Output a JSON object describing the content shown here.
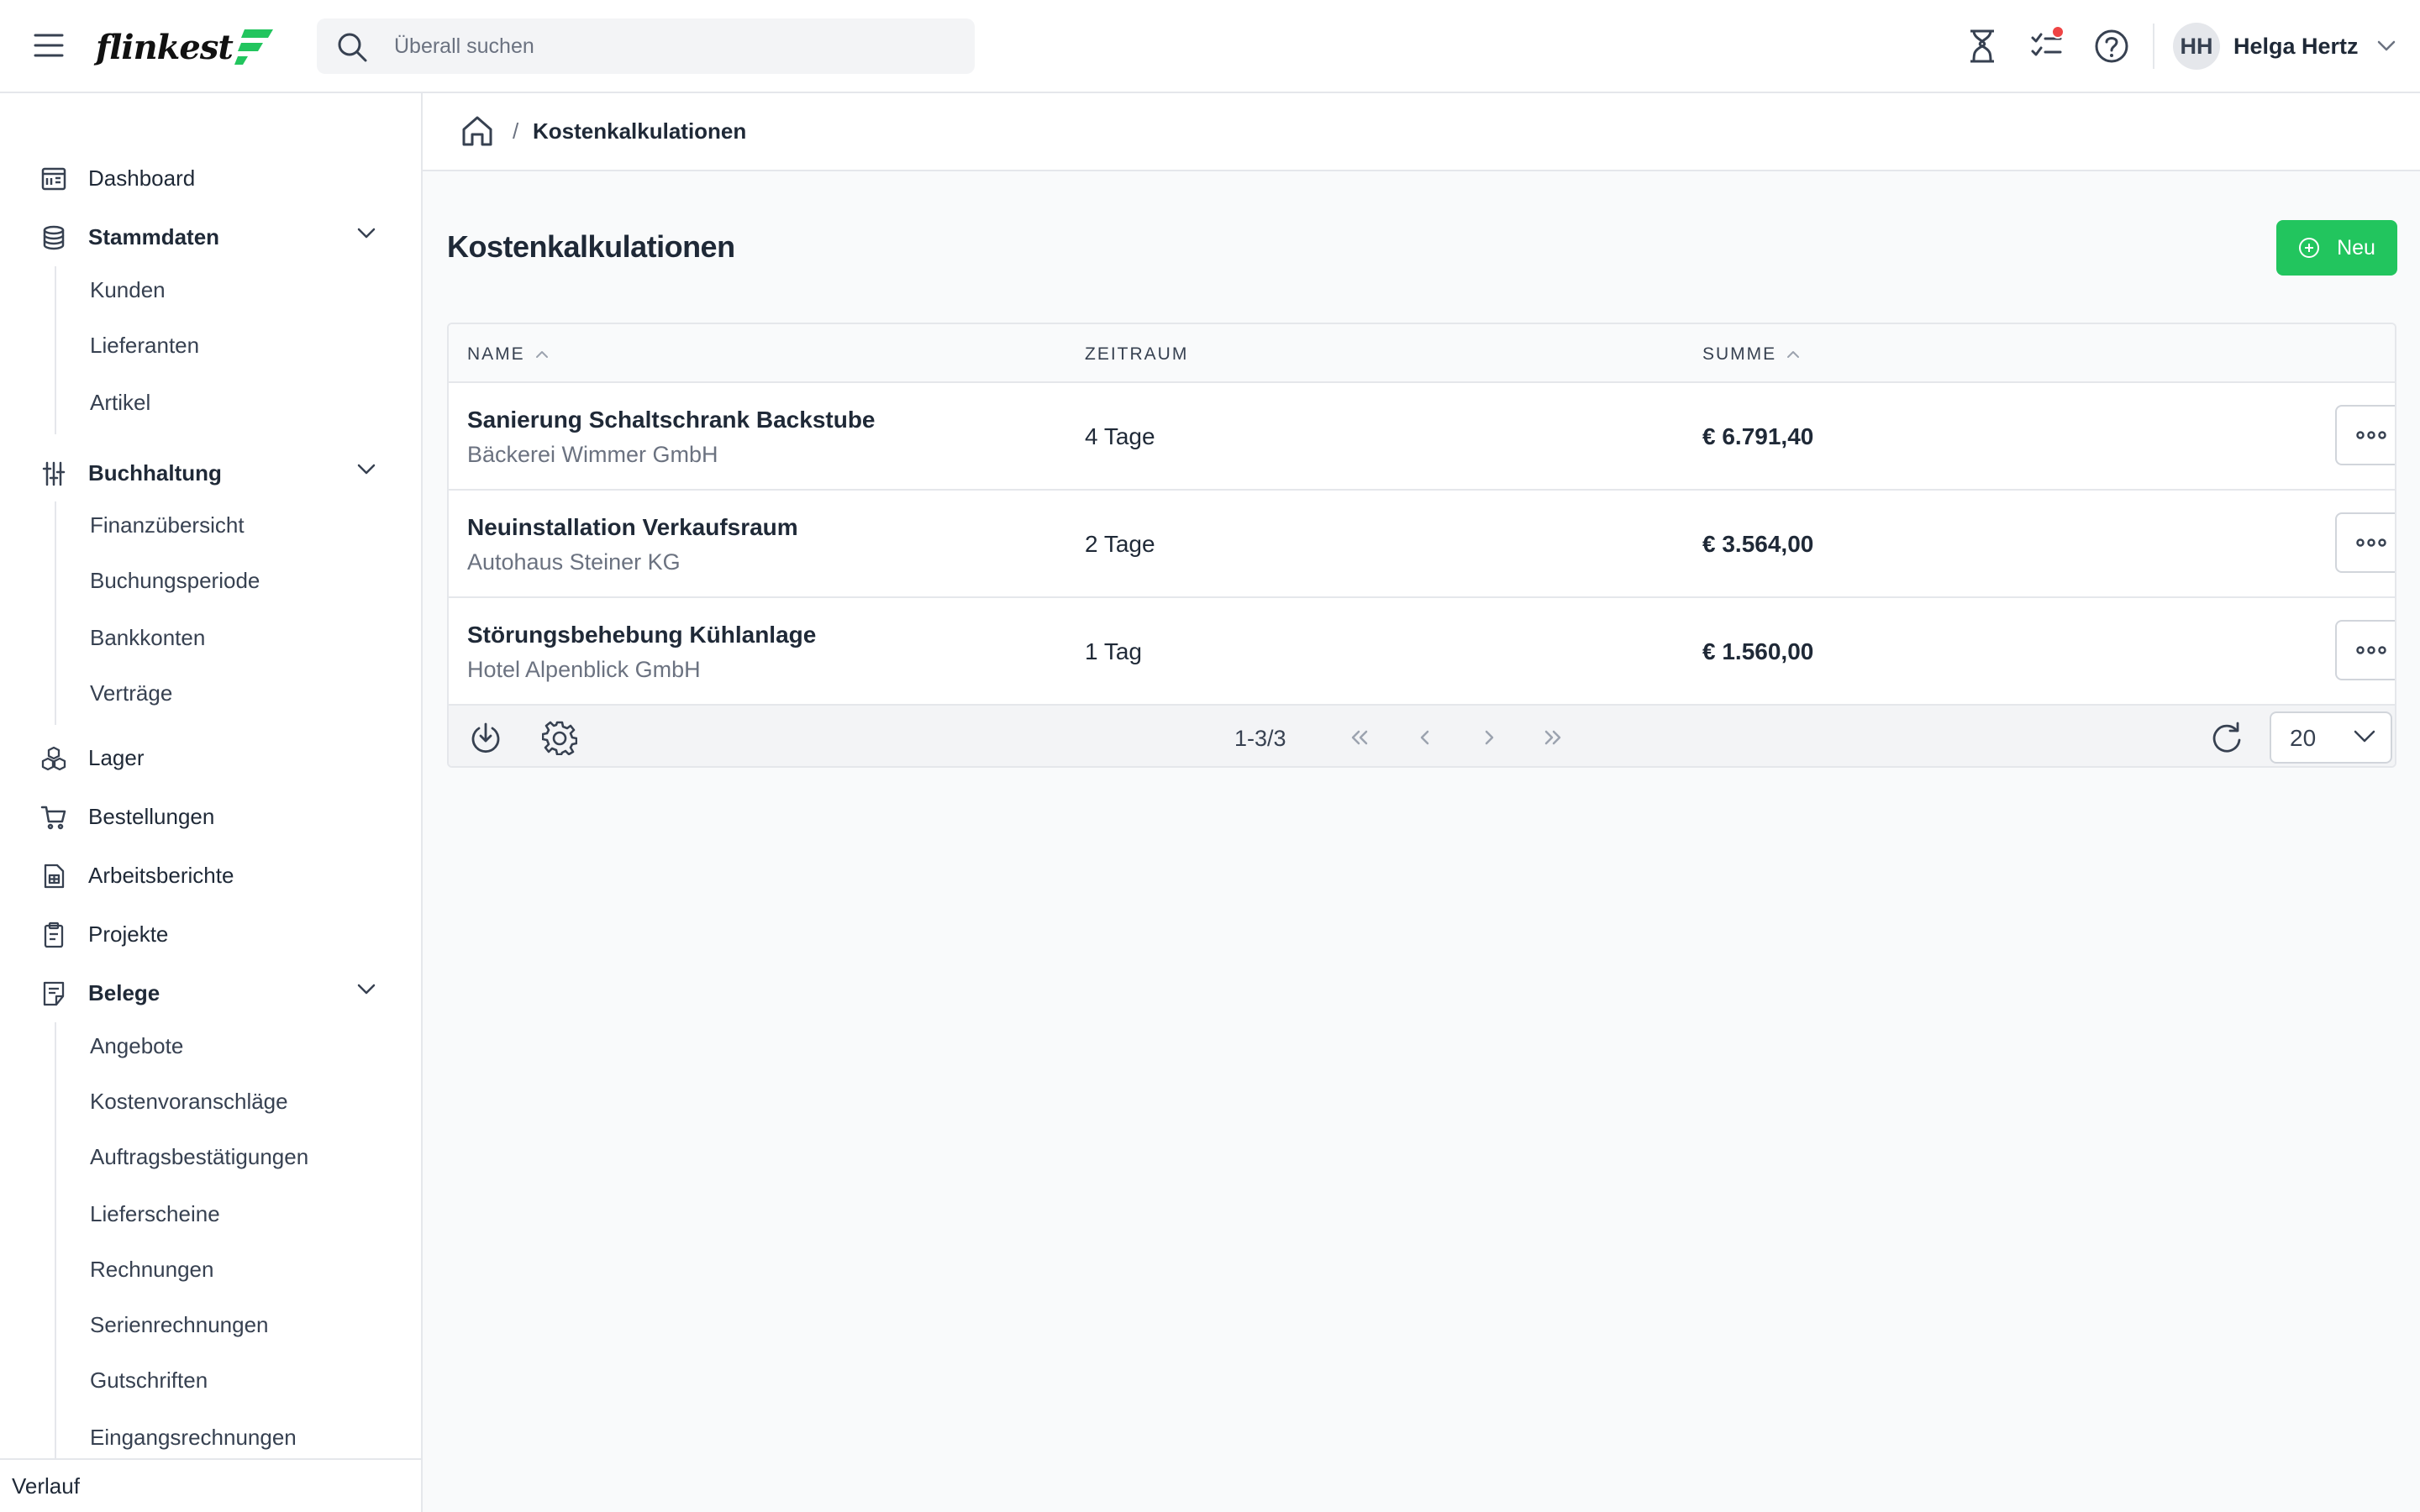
{
  "app": {
    "logo_text": "flinkest",
    "search_placeholder": "Überall suchen",
    "user_initials": "HH",
    "user_name": "Helga Hertz"
  },
  "sidebar": {
    "dashboard": "Dashboard",
    "stammdaten": {
      "label": "Stammdaten",
      "items": [
        "Kunden",
        "Lieferanten",
        "Artikel"
      ]
    },
    "buchhaltung": {
      "label": "Buchhaltung",
      "items": [
        "Finanzübersicht",
        "Buchungsperiode",
        "Bankkonten",
        "Verträge"
      ]
    },
    "lager": "Lager",
    "bestellungen": "Bestellungen",
    "arbeitsberichte": "Arbeitsberichte",
    "projekte": "Projekte",
    "belege": {
      "label": "Belege",
      "items": [
        "Angebote",
        "Kostenvoranschläge",
        "Auftragsbestätigungen",
        "Lieferscheine",
        "Rechnungen",
        "Serienrechnungen",
        "Gutschriften",
        "Eingangsrechnungen"
      ]
    },
    "footer": "Verlauf"
  },
  "breadcrumb": {
    "separator": "/",
    "current": "Kostenkalkulationen"
  },
  "page": {
    "title": "Kostenkalkulationen",
    "new_button": "Neu"
  },
  "table": {
    "headers": {
      "name": "NAME",
      "period": "ZEITRAUM",
      "sum": "SUMME"
    },
    "rows": [
      {
        "name": "Sanierung Schaltschrank Backstube",
        "customer": "Bäckerei Wimmer GmbH",
        "period": "4 Tage",
        "sum": "€ 6.791,40"
      },
      {
        "name": "Neuinstallation Verkaufsraum",
        "customer": "Autohaus Steiner KG",
        "period": "2 Tage",
        "sum": "€ 3.564,00"
      },
      {
        "name": "Störungsbehebung Kühlanlage",
        "customer": "Hotel Alpenblick GmbH",
        "period": "1 Tag",
        "sum": "€ 1.560,00"
      }
    ],
    "footer": {
      "range": "1-3/3",
      "page_size": "20"
    }
  },
  "colors": {
    "accent": "#22c55e",
    "notification": "#ef4444"
  }
}
